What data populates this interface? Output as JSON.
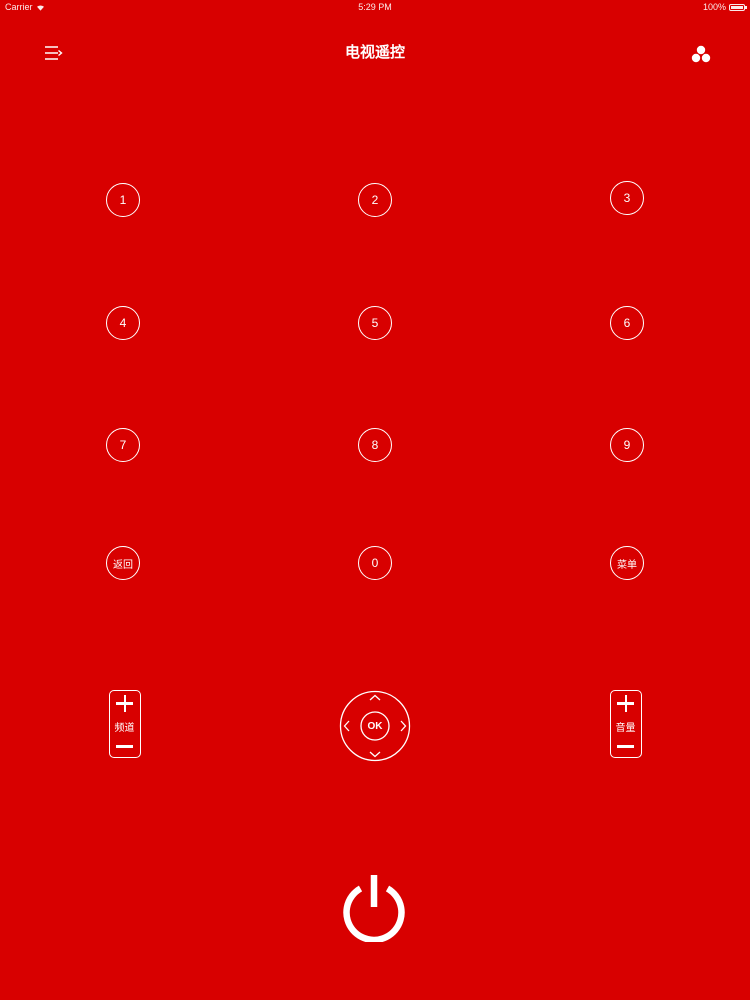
{
  "status_bar": {
    "carrier": "Carrier",
    "time": "5:29 PM",
    "battery": "100%"
  },
  "nav": {
    "title": "电视遥控",
    "menu_icon": "menu-icon",
    "share_icon": "cluster-icon"
  },
  "keypad": {
    "k1": "1",
    "k2": "2",
    "k3": "3",
    "k4": "4",
    "k5": "5",
    "k6": "6",
    "k7": "7",
    "k8": "8",
    "k9": "9",
    "back": "返回",
    "k0": "0",
    "menu": "菜单"
  },
  "channel": {
    "label": "频道"
  },
  "dpad": {
    "ok": "OK"
  },
  "volume": {
    "label": "音量"
  },
  "colors": {
    "background": "#d80000",
    "foreground": "#ffffff"
  }
}
